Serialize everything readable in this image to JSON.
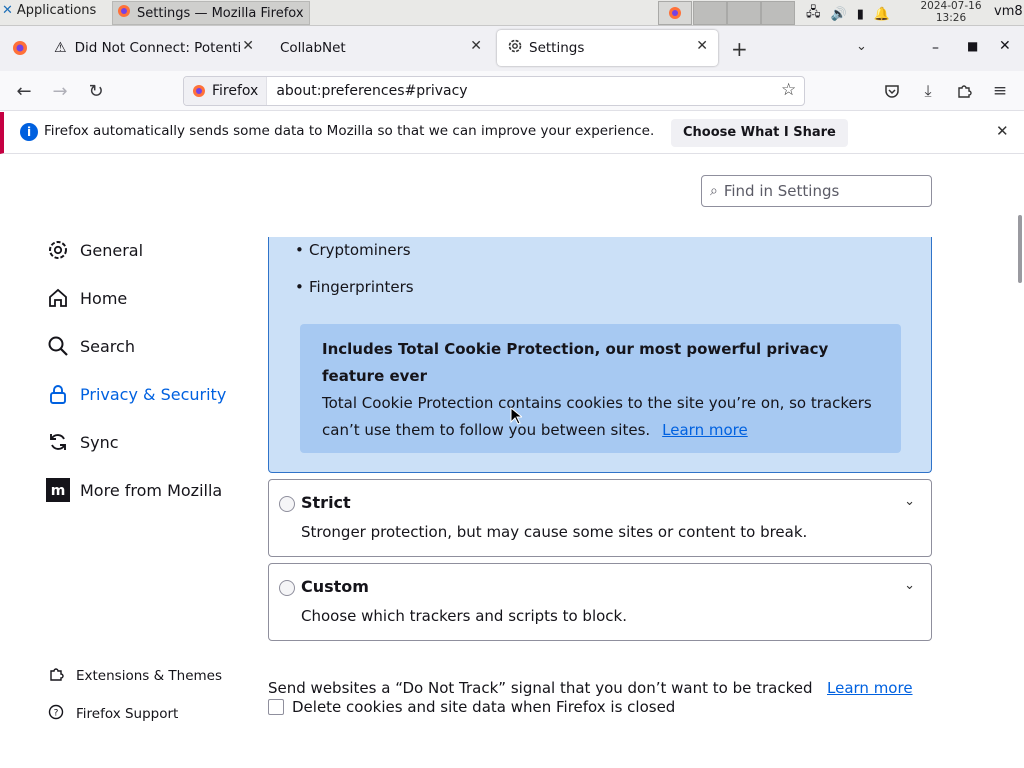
{
  "taskbar": {
    "app_menu": "Applications",
    "task_title": "Settings — Mozilla Firefox",
    "clock_date": "2024-07-16",
    "clock_time": "13:26",
    "user": "vm8"
  },
  "tabs": [
    {
      "label": "Did Not Connect: Potenti",
      "icon": "warning-icon"
    },
    {
      "label": "CollabNet",
      "icon": ""
    },
    {
      "label": "Settings",
      "icon": "gear-icon"
    }
  ],
  "urlbar": {
    "identity": "Firefox",
    "url": "about:preferences#privacy"
  },
  "notification": {
    "message": "Firefox automatically sends some data to Mozilla so that we can improve your experience.",
    "button": "Choose What I Share"
  },
  "search": {
    "placeholder": "Find in Settings"
  },
  "sidebar": {
    "items": [
      {
        "label": "General",
        "icon": "gear-icon"
      },
      {
        "label": "Home",
        "icon": "home-icon"
      },
      {
        "label": "Search",
        "icon": "search-icon"
      },
      {
        "label": "Privacy & Security",
        "icon": "lock-icon"
      },
      {
        "label": "Sync",
        "icon": "sync-icon"
      },
      {
        "label": "More from Mozilla",
        "icon": "mozilla-icon"
      }
    ],
    "footer": [
      {
        "label": "Extensions & Themes",
        "icon": "puzzle-icon"
      },
      {
        "label": "Firefox Support",
        "icon": "help-icon"
      }
    ]
  },
  "standard": {
    "list": [
      "Cryptominers",
      "Fingerprinters"
    ],
    "tcp_heading": "Includes Total Cookie Protection, our most powerful privacy feature ever",
    "tcp_text": "Total Cookie Protection contains cookies to the site you’re on, so trackers can’t use them to follow you between sites.",
    "learn_more": "Learn more"
  },
  "options": [
    {
      "title": "Strict",
      "desc": "Stronger protection, but may cause some sites or content to break."
    },
    {
      "title": "Custom",
      "desc": "Choose which trackers and scripts to block."
    }
  ],
  "dnt": {
    "text": "Send websites a “Do Not Track” signal that you don’t want to be tracked",
    "learn_more": "Learn more"
  },
  "delete_cookies": {
    "label": "Delete cookies and site data when Firefox is closed",
    "checked": false
  },
  "colors": {
    "accent": "#0061e0",
    "selected_box": "#cbe0f7",
    "tcp_box": "#a7c9f2",
    "notification_border": "#c50042"
  }
}
